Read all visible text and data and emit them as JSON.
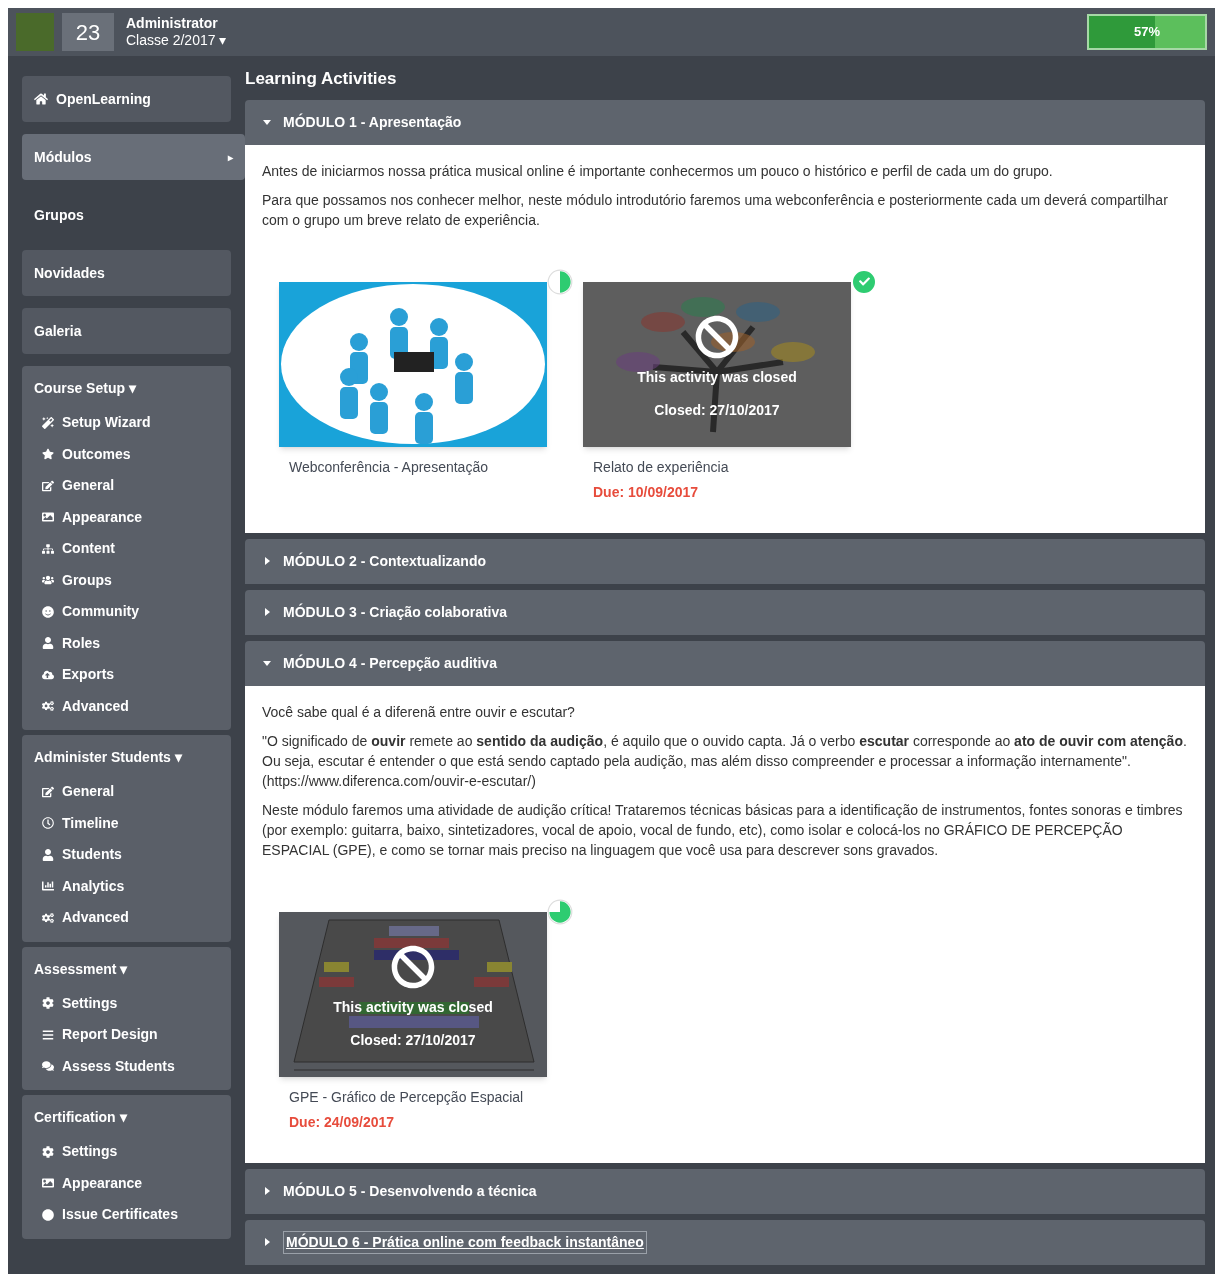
{
  "topbar": {
    "count": "23",
    "user": "Administrator",
    "class_name": "Classe 2/2017",
    "caret": "▾",
    "progress": {
      "label": "57%",
      "level": 0.57
    }
  },
  "sidebar": {
    "nav": [
      {
        "label": "OpenLearning",
        "selected": false,
        "hovered": false
      },
      {
        "label": "Módulos",
        "selected": true,
        "hovered": false,
        "caret": "▸"
      },
      {
        "label": "Grupos",
        "selected": false,
        "hovered": true
      },
      {
        "label": "Novidades",
        "selected": false,
        "hovered": false
      },
      {
        "label": "Galeria",
        "selected": false,
        "hovered": false
      }
    ],
    "groups": [
      {
        "title": "Course Setup",
        "caret": "▾",
        "items": [
          "Setup Wizard",
          "Outcomes",
          "General",
          "Appearance",
          "Content",
          "Groups",
          "Community",
          "Roles",
          "Exports",
          "Advanced"
        ]
      },
      {
        "title": "Administer Students",
        "caret": "▾",
        "items": [
          "General",
          "Timeline",
          "Students",
          "Analytics",
          "Advanced"
        ]
      },
      {
        "title": "Assessment",
        "caret": "▾",
        "items": [
          "Settings",
          "Report Design",
          "Assess Students"
        ]
      },
      {
        "title": "Certification",
        "caret": "▾",
        "items": [
          "Settings",
          "Appearance",
          "Issue Certificates"
        ]
      }
    ]
  },
  "main": {
    "title": "Learning Activities",
    "modules": [
      {
        "title": "MÓDULO 1 - Apresentação",
        "expanded": true,
        "hovered": false,
        "paragraphs": [
          "Antes de iniciarmos nossa prática musical online é importante conhecermos um pouco o histórico e perfil de cada um do grupo.",
          "Para que possamos nos conhecer melhor, neste módulo introdutório faremos uma webconferência e posteriormente cada um deverá compartilhar com o grupo um breve relato de experiência."
        ],
        "activities": [
          {
            "title": "Webconferência - Apresentação",
            "status": {
              "kind": "pie",
              "level": 0.5
            }
          },
          {
            "title": "Relato de experiência",
            "due": "Due: 10/09/2017",
            "status": {
              "kind": "check"
            },
            "closed": {
              "message": "This activity was closed",
              "date": "Closed: 27/10/2017"
            }
          }
        ]
      },
      {
        "title": "MÓDULO 2 - Contextualizando",
        "expanded": false,
        "hovered": false
      },
      {
        "title": "MÓDULO 3 - Criação colaborativa",
        "expanded": false,
        "hovered": false
      },
      {
        "title": "MÓDULO 4 - Percepção auditiva",
        "expanded": true,
        "hovered": false,
        "paragraphs": [
          "Você sabe qual é a diferenã entre ouvir e escutar?",
          "\"O significado de **ouvir** remete ao **sentido da audição**, é aquilo que o ouvido capta. Já o verbo **escutar** corresponde ao **ato de ouvir com atenção**. Ou seja, escutar é entender o que está sendo captado pela audição, mas além disso compreender e processar a informação internamente\". (https://www.diferenca.com/ouvir-e-escutar/)",
          "Neste módulo faremos uma atividade de audição crítica! Trataremos técnicas básicas para a identificação de instrumentos, fontes sonoras e timbres (por exemplo: guitarra, baixo, sintetizadores, vocal de apoio, vocal de fundo, etc), como isolar e colocá-los no GRÁFICO DE PERCEPÇÃO ESPACIAL (GPE), e como se tornar mais preciso na linguagem que você usa para descrever sons gravados."
        ],
        "activities": [
          {
            "title": "GPE - Gráfico de Percepção Espacial",
            "due": "Due: 24/09/2017",
            "status": {
              "kind": "pie",
              "level": 0.75
            },
            "closed": {
              "message": "This activity was closed",
              "date": "Closed: 27/10/2017"
            }
          }
        ]
      },
      {
        "title": "MÓDULO 5 - Desenvolvendo a técnica",
        "expanded": false,
        "hovered": false
      },
      {
        "title": "MÓDULO 6 - Prática online com feedback instantâneo",
        "expanded": false,
        "hovered": true
      }
    ]
  }
}
